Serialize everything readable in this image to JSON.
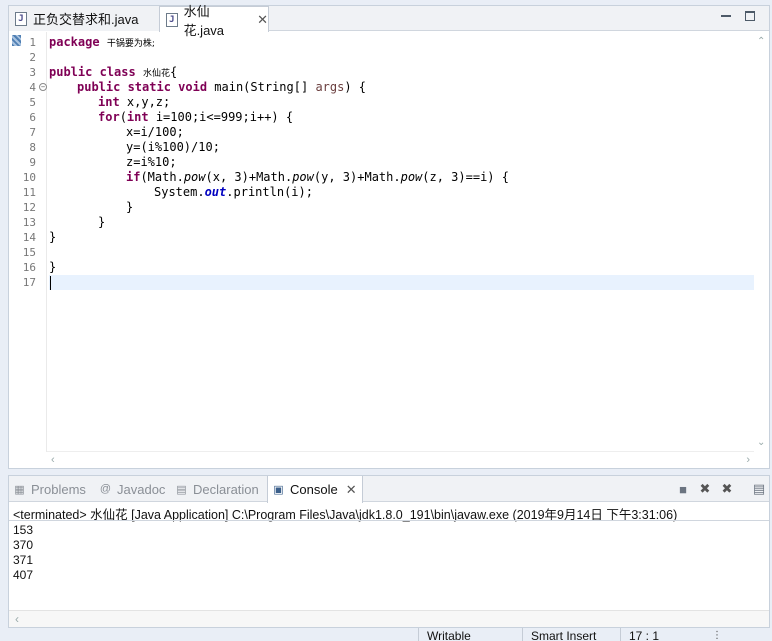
{
  "editor": {
    "tabs": [
      {
        "label": "正负交替求和.java",
        "active": false
      },
      {
        "label": "水仙花.java",
        "active": true
      }
    ],
    "line_numbers": [
      "1",
      "2",
      "3",
      "4",
      "5",
      "6",
      "7",
      "8",
      "9",
      "10",
      "11",
      "12",
      "13",
      "14",
      "15",
      "16",
      "17"
    ],
    "code": {
      "l1_kw": "package",
      "l1_name": "干锅要为株;",
      "l3_kw": "public class",
      "l3_name": "水仙花",
      "l3_rest": "{",
      "l4_kw": "public static void",
      "l4_rest": "main(String[] ",
      "l4_arg": "args",
      "l4_end": ") {",
      "l5_kw": "int",
      "l5_rest": " x,y,z;",
      "l6_kw1": "for",
      "l6_mid": "(",
      "l6_kw2": "int",
      "l6_rest": " i=100;i<=999;i++) {",
      "l7": "x=i/100;",
      "l8": "y=(i%100)/10;",
      "l9": "z=i%10;",
      "l10_kw": "if",
      "l10_a": "(Math.",
      "l10_pow1": "pow",
      "l10_b": "(x, 3)+Math.",
      "l10_pow2": "pow",
      "l10_c": "(y, 3)+Math.",
      "l10_pow3": "pow",
      "l10_d": "(z, 3)==i) {",
      "l11_a": "System.",
      "l11_out": "out",
      "l11_b": ".println(i);",
      "l12": "}",
      "l13": "}",
      "l14": "}",
      "l16": "}"
    }
  },
  "views": {
    "tabs": [
      {
        "label": "Problems"
      },
      {
        "label": "Javadoc"
      },
      {
        "label": "Declaration"
      },
      {
        "label": "Console",
        "active": true
      }
    ],
    "console": {
      "terminated_text": "<terminated> 水仙花 [Java Application] C:\\Program Files\\Java\\jdk1.8.0_191\\bin\\javaw.exe (2019年9月14日 下午3:31:06)",
      "output": [
        "153",
        "370",
        "371",
        "407"
      ]
    }
  },
  "status_bar": {
    "writable": "Writable",
    "insert_mode": "Smart Insert",
    "position": "17 : 1"
  }
}
